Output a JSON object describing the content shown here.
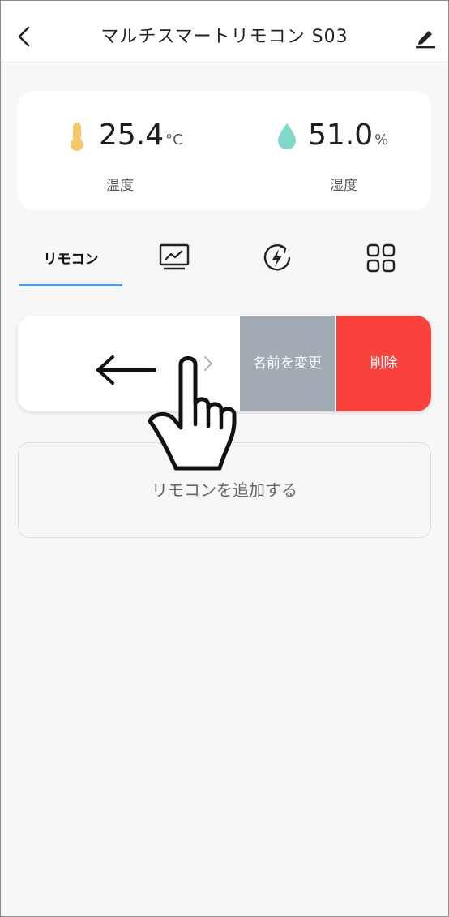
{
  "header": {
    "title": "マルチスマートリモコン S03"
  },
  "sensors": {
    "temperature": {
      "value": "25.4",
      "unit": "°C",
      "label": "温度"
    },
    "humidity": {
      "value": "51.0",
      "unit": "%",
      "label": "湿度"
    }
  },
  "tabs": {
    "remote_label": "リモコン"
  },
  "swipe_row": {
    "rename_label": "名前を変更",
    "delete_label": "削除"
  },
  "add_remote": {
    "label": "リモコンを追加する"
  },
  "colors": {
    "accent": "#4a9be8",
    "delete": "#f8423b",
    "rename": "#a2aab3",
    "thermometer": "#f5c86a",
    "drop": "#7fd8c9"
  }
}
